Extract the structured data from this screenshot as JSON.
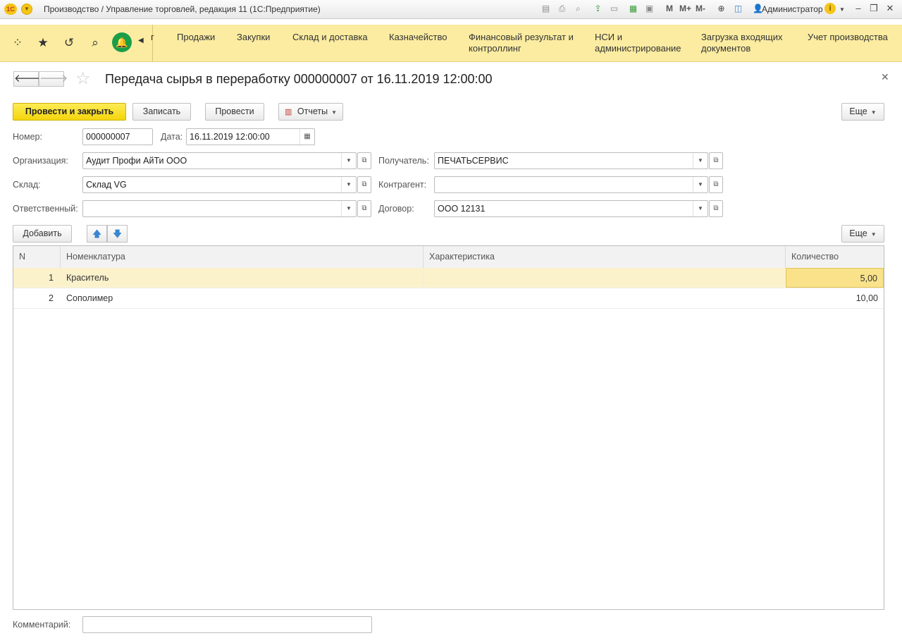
{
  "window": {
    "title": "Производство / Управление торговлей, редакция 11  (1С:Предприятие)",
    "logo_text": "1С",
    "user": "Администратор",
    "toolbar_m_labels": [
      "M",
      "M+",
      "M-"
    ]
  },
  "sections": [
    {
      "label": "г"
    },
    {
      "label": "Продажи"
    },
    {
      "label": "Закупки"
    },
    {
      "label": "Склад и доставка"
    },
    {
      "label": "Казначейство"
    },
    {
      "label": "Финансовый результат и",
      "label2": "контроллинг"
    },
    {
      "label": "НСИ и",
      "label2": "администрирование"
    },
    {
      "label": "Загрузка входящих",
      "label2": "документов"
    },
    {
      "label": "Учет производства"
    }
  ],
  "form": {
    "title": "Передача сырья в переработку 000000007 от 16.11.2019 12:00:00"
  },
  "commands": {
    "post_close": "Провести и закрыть",
    "save": "Записать",
    "post": "Провести",
    "reports": "Отчеты",
    "more": "Еще"
  },
  "fields": {
    "number_label": "Номер:",
    "number_value": "000000007",
    "date_label": "Дата:",
    "date_value": "16.11.2019 12:00:00",
    "org_label": "Организация:",
    "org_value": "Аудит Профи АйТи ООО",
    "warehouse_label": "Склад:",
    "warehouse_value": "Склад VG",
    "responsible_label": "Ответственный:",
    "responsible_value": "",
    "recipient_label": "Получатель:",
    "recipient_value": "ПЕЧАТЬСЕРВИС",
    "counterparty_label": "Контрагент:",
    "counterparty_value": "",
    "contract_label": "Договор:",
    "contract_value": "ООО 12131",
    "comment_label": "Комментарий:",
    "comment_value": ""
  },
  "table_toolbar": {
    "add": "Добавить",
    "more": "Еще"
  },
  "table": {
    "columns": [
      "N",
      "Номенклатура",
      "Характеристика",
      "Количество"
    ],
    "rows": [
      {
        "n": "1",
        "item": "Краситель",
        "characteristic": "",
        "qty": "5,00"
      },
      {
        "n": "2",
        "item": "Сополимер",
        "characteristic": "",
        "qty": "10,00"
      }
    ]
  }
}
